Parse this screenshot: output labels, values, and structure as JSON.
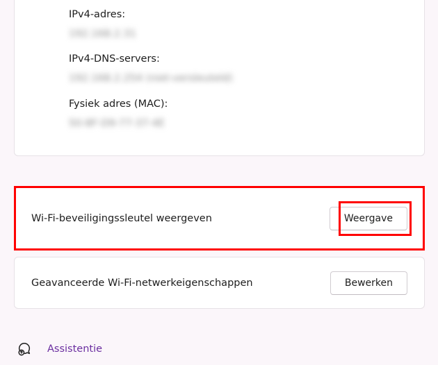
{
  "network_info": {
    "ipv4_address_label": "IPv4-adres:",
    "ipv4_address_value": "192.168.2.31",
    "ipv4_dns_label": "IPv4-DNS-servers:",
    "ipv4_dns_value": "192.168.2.254 (niet-versleuteld)",
    "mac_label": "Fysiek adres (MAC):",
    "mac_value": "50-8F-D9-77-37-4E"
  },
  "wifi_key": {
    "label": "Wi-Fi-beveiligingssleutel weergeven",
    "button": "Weergave"
  },
  "advanced": {
    "label": "Geavanceerde Wi-Fi-netwerkeigenschappen",
    "button": "Bewerken"
  },
  "assist": {
    "label": "Assistentie"
  }
}
